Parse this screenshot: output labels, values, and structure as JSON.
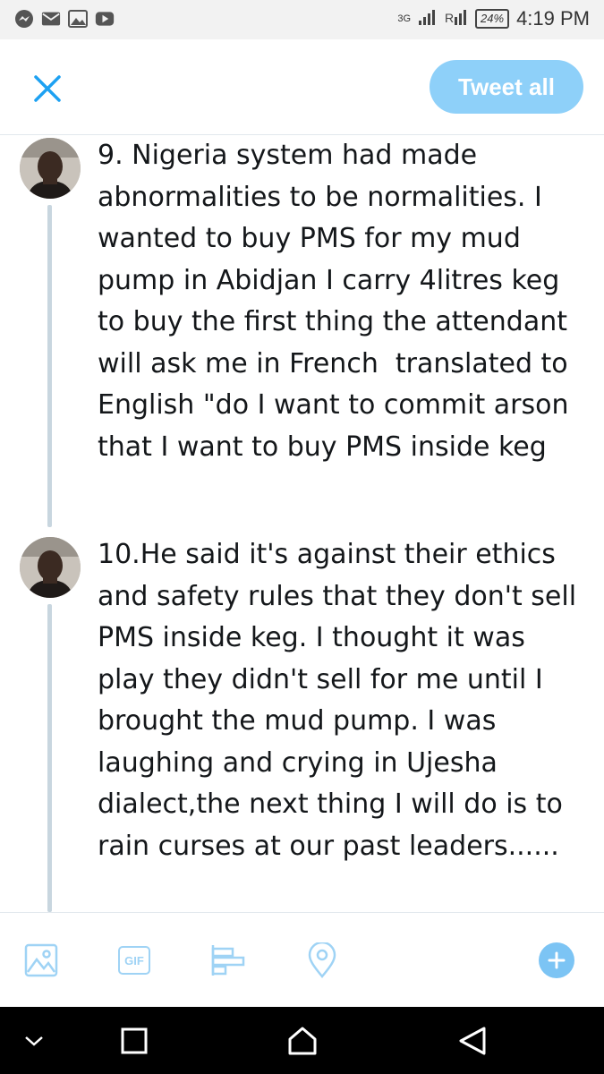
{
  "status_bar": {
    "network_label": "3G",
    "battery": "24%",
    "time": "4:19 PM",
    "icons": [
      "messenger-icon",
      "mail-icon",
      "gallery-icon",
      "youtube-icon",
      "signal-icon",
      "signal-icon"
    ]
  },
  "header": {
    "close_icon": "close-icon",
    "tweet_all_label": "Tweet all",
    "accent_color": "#1da1f2",
    "button_color": "#8ed0f9"
  },
  "thread": {
    "tweets": [
      {
        "text": "9. Nigeria system had made abnormalities to be normalities. I wanted to buy PMS for my mud pump in Abidjan I carry 4litres keg to buy the first thing the attendant will ask me in French  translated to English \"do I want to commit arson that I want to buy PMS inside keg"
      },
      {
        "text": "10.He said it's against their ethics and safety rules that they don't sell PMS inside keg. I thought it was play they didn't sell for me until I brought the mud pump. I was laughing and crying in Ujesha dialect,the next thing I will do is to rain curses at our past leaders......"
      }
    ]
  },
  "toolbar": {
    "items": [
      "image-icon",
      "gif-icon",
      "poll-icon",
      "location-icon",
      "add-tweet-icon"
    ],
    "gif_label": "GIF"
  },
  "navbar": {
    "items": [
      "chevron-down-icon",
      "recents-icon",
      "home-icon",
      "back-icon"
    ]
  }
}
